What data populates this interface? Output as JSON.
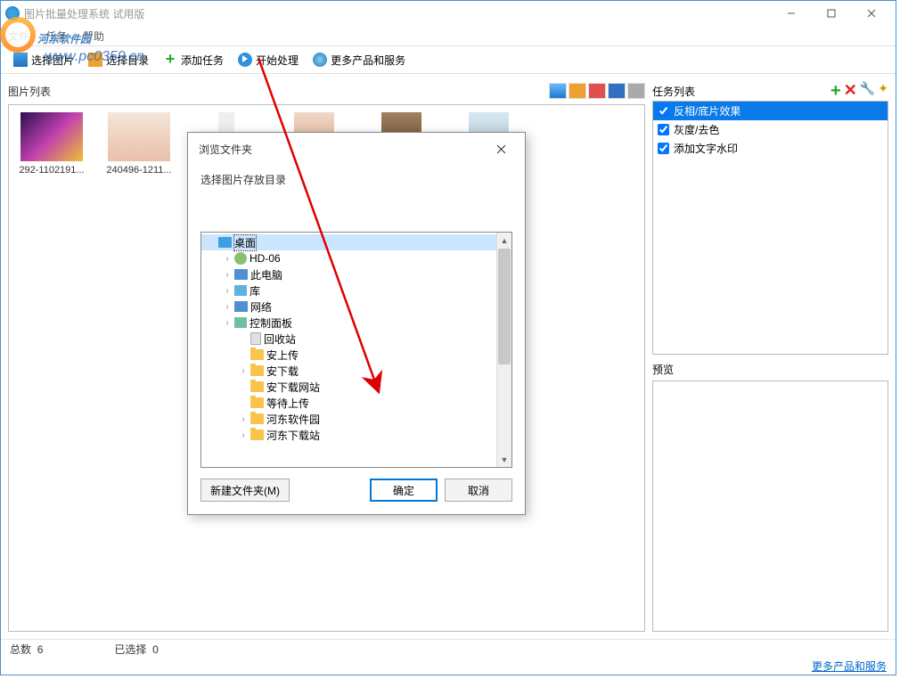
{
  "window": {
    "title": "图片批量处理系统 试用版"
  },
  "menu": {
    "file": "文件",
    "task": "任务",
    "help": "帮助"
  },
  "toolbar": {
    "select_images": "选择图片",
    "select_folder": "选择目录",
    "add_task": "添加任务",
    "start": "开始处理",
    "more": "更多产品和服务"
  },
  "left": {
    "title": "图片列表",
    "thumbs": [
      {
        "label": "292-1102191..."
      },
      {
        "label": "240496-1211..."
      }
    ]
  },
  "tasks": {
    "title": "任务列表",
    "items": [
      {
        "label": "反相/底片效果",
        "checked": true,
        "selected": true
      },
      {
        "label": "灰度/去色",
        "checked": true,
        "selected": false
      },
      {
        "label": "添加文字水印",
        "checked": true,
        "selected": false
      }
    ]
  },
  "preview": {
    "title": "预览"
  },
  "status": {
    "total_label": "总数",
    "total": "6",
    "selected_label": "已选择",
    "selected": "0"
  },
  "footer": {
    "link": "更多产品和服务"
  },
  "watermark": {
    "text": "河东软件园",
    "url": "www.pc0359.cn"
  },
  "dialog": {
    "title": "浏览文件夹",
    "label": "选择图片存放目录",
    "nodes": [
      {
        "label": "桌面",
        "depth": 0,
        "exp": "",
        "icon": "desktop",
        "selected": true
      },
      {
        "label": "HD-06",
        "depth": 1,
        "exp": "›",
        "icon": "user"
      },
      {
        "label": "此电脑",
        "depth": 1,
        "exp": "›",
        "icon": "pc"
      },
      {
        "label": "库",
        "depth": 1,
        "exp": "›",
        "icon": "lib"
      },
      {
        "label": "网络",
        "depth": 1,
        "exp": "›",
        "icon": "net"
      },
      {
        "label": "控制面板",
        "depth": 1,
        "exp": "›",
        "icon": "cp"
      },
      {
        "label": "回收站",
        "depth": 2,
        "exp": "",
        "icon": "bin"
      },
      {
        "label": "安上传",
        "depth": 2,
        "exp": "",
        "icon": "folder"
      },
      {
        "label": "安下载",
        "depth": 2,
        "exp": "›",
        "icon": "folder"
      },
      {
        "label": "安下载网站",
        "depth": 2,
        "exp": "",
        "icon": "folder"
      },
      {
        "label": "等待上传",
        "depth": 2,
        "exp": "",
        "icon": "folder"
      },
      {
        "label": "河东软件园",
        "depth": 2,
        "exp": "›",
        "icon": "folder"
      },
      {
        "label": "河东下载站",
        "depth": 2,
        "exp": "›",
        "icon": "folder"
      }
    ],
    "new_folder": "新建文件夹(M)",
    "ok": "确定",
    "cancel": "取消"
  }
}
